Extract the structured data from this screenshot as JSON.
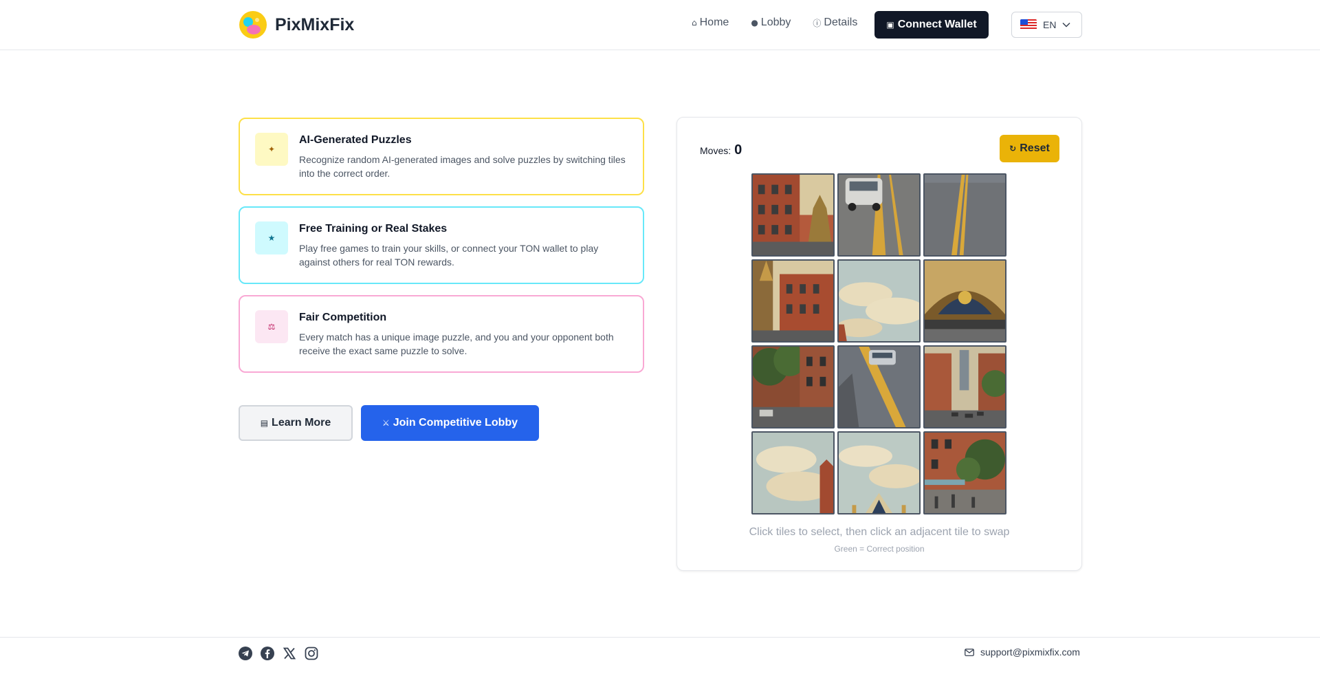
{
  "brand": {
    "name": "PixMixFix"
  },
  "nav": {
    "items": [
      {
        "label": "Home",
        "icon": "home-icon"
      },
      {
        "label": "Lobby",
        "icon": "users-icon"
      },
      {
        "label": "Details",
        "icon": "info-icon"
      }
    ],
    "connect_label": "Connect Wallet",
    "language": "EN"
  },
  "features": [
    {
      "title": "AI-Generated Puzzles",
      "description": "Recognize random AI-generated images and solve puzzles by switching tiles into the correct order.",
      "icon": "puzzle-icon",
      "accent": "#fde047"
    },
    {
      "title": "Free Training or Real Stakes",
      "description": "Play free games to train your skills, or connect your TON wallet to play against others for real TON rewards.",
      "icon": "trophy-icon",
      "accent": "#67e8f9"
    },
    {
      "title": "Fair Competition",
      "description": "Every match has a unique image puzzle, and you and your opponent both receive the exact same puzzle to solve.",
      "icon": "scale-icon",
      "accent": "#f9a8d4"
    }
  ],
  "actions": {
    "learn_more": "Learn More",
    "join_lobby": "Join Competitive Lobby"
  },
  "game": {
    "moves_label": "Moves:",
    "moves_value": "0",
    "reset_label": "Reset",
    "hint": "Click tiles to select, then click an adjacent tile to swap",
    "legend": "Green = Correct position"
  },
  "footer": {
    "socials": [
      "telegram-icon",
      "facebook-icon",
      "x-icon",
      "instagram-icon"
    ],
    "email": "support@pixmixfix.com"
  },
  "colors": {
    "primary": "#2563eb",
    "dark": "#111827",
    "reset": "#eab308"
  }
}
